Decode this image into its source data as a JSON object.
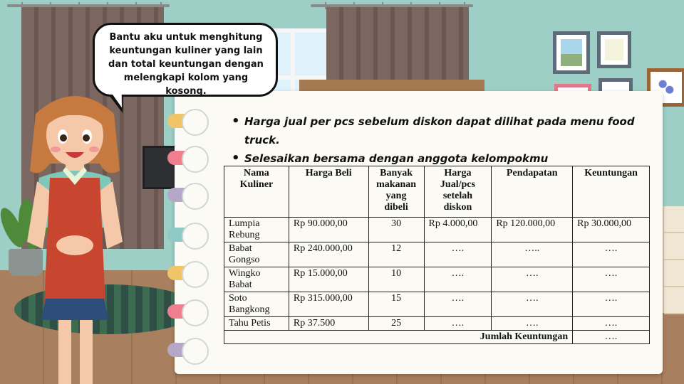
{
  "speech_bubble": {
    "text": "Bantu aku untuk menghitung keuntungan kuliner yang lain dan total keuntungan dengan melengkapi kolom yang kosong."
  },
  "instructions": [
    "Harga jual per pcs sebelum diskon dapat dilihat pada menu food truck.",
    "Selesaikan bersama dengan anggota kelompokmu"
  ],
  "table": {
    "headers": [
      "Nama Kuliner",
      "Harga Beli",
      "Banyak makanan yang dibeli",
      "Harga Jual/pcs setelah diskon",
      "Pendapatan",
      "Keuntungan"
    ],
    "rows": [
      [
        "Lumpia Rebung",
        "Rp 90.000,00",
        "30",
        "Rp 4.000,00",
        "Rp 120.000,00",
        "Rp 30.000,00"
      ],
      [
        "Babat Gongso",
        "Rp 240.000,00",
        "12",
        "….",
        "…..",
        "…."
      ],
      [
        "Wingko Babat",
        "Rp 15.000,00",
        "10",
        "….",
        "….",
        "…."
      ],
      [
        "Soto Bangkong",
        "Rp 315.000,00",
        "15",
        "….",
        "….",
        "…."
      ],
      [
        "Tahu Petis",
        "Rp 37.500",
        "25",
        "….",
        "….",
        "…."
      ]
    ],
    "total_label": "Jumlah Keuntungan",
    "total_value": "…."
  },
  "colors": {
    "wall": "#9ecfc6",
    "card": "#fbfaf4",
    "ring_yellow": "#f0c56a",
    "ring_pink": "#ef7f8f",
    "ring_purple": "#b4a8c6",
    "ring_teal": "#8fc9c6",
    "apron": "#c8452f",
    "shirt": "#7fc7b9",
    "hair": "#c77a3f"
  }
}
